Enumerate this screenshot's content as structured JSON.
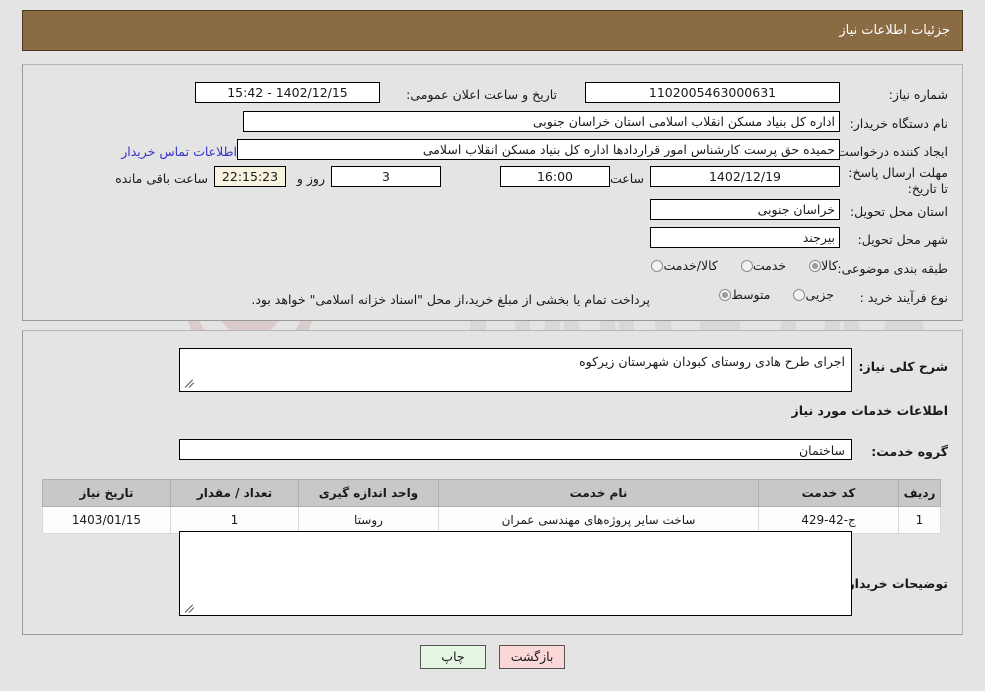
{
  "header": {
    "title": "جزئیات اطلاعات نیاز"
  },
  "top_panel": {
    "need_number": {
      "label": "شماره نیاز:",
      "value": "1102005463000631"
    },
    "announce_datetime": {
      "label": "تاریخ و ساعت اعلان عمومی:",
      "value": "1402/12/15 - 15:42"
    },
    "buyer_org": {
      "label": "نام دستگاه خریدار:",
      "value": "اداره کل بنیاد مسکن انقلاب اسلامی استان خراسان جنوبی"
    },
    "creator": {
      "label": "ایجاد کننده درخواست:",
      "value": "حمیده حق پرست کارشناس امور قراردادها اداره کل بنیاد مسکن انقلاب اسلامی",
      "contact_link": "اطلاعات تماس خریدار"
    },
    "deadline": {
      "label": "مهلت ارسال پاسخ: تا تاریخ:",
      "date": "1402/12/19",
      "time_label": "ساعت",
      "time": "16:00",
      "days": "3",
      "days_label": "روز و",
      "countdown": "22:15:23",
      "remaining_label": "ساعت باقی مانده"
    },
    "province": {
      "label": "استان محل تحویل:",
      "value": "خراسان جنوبی"
    },
    "city": {
      "label": "شهر محل تحویل:",
      "value": "بیرجند"
    },
    "category": {
      "label": "طبقه بندی موضوعی:",
      "options": [
        {
          "label": "کالا",
          "checked": true
        },
        {
          "label": "خدمت",
          "checked": false
        },
        {
          "label": "کالا/خدمت",
          "checked": false
        }
      ]
    },
    "process_type": {
      "label": "نوع فرآیند خرید :",
      "options": [
        {
          "label": "جزیی",
          "checked": false
        },
        {
          "label": "متوسط",
          "checked": true
        }
      ],
      "note": "پرداخت تمام یا بخشی از مبلغ خرید،از محل \"اسناد خزانه اسلامی\" خواهد بود."
    }
  },
  "middle_panel": {
    "general_description": {
      "label": "شرح کلی نیاز:",
      "value": "اجرای طرح هادی روستای کبودان شهرستان زیرکوه"
    },
    "services_section_title": "اطلاعات خدمات مورد نیاز",
    "service_group": {
      "label": "گروه خدمت:",
      "value": "ساختمان"
    },
    "table": {
      "headers": [
        "ردیف",
        "کد خدمت",
        "نام خدمت",
        "واحد اندازه گیری",
        "تعداد / مقدار",
        "تاریخ نیاز"
      ],
      "rows": [
        [
          "1",
          "ج-42-429",
          "ساخت سایر پروژه‌های مهندسی عمران",
          "روستا",
          "1",
          "1403/01/15"
        ]
      ]
    },
    "buyer_notes": {
      "label": "توضیحات خریدار:",
      "value": ""
    }
  },
  "buttons": {
    "back": "بازگشت",
    "print": "چاپ"
  },
  "watermark": {
    "text": "AriaTender.ne"
  },
  "colors": {
    "header_bg": "#8b6b43",
    "page_bg": "#e4e4e4",
    "link": "#3333cc",
    "back_btn": "#fbd7d7",
    "print_btn": "#e5f6e3",
    "table_header": "#c8c8c8"
  }
}
